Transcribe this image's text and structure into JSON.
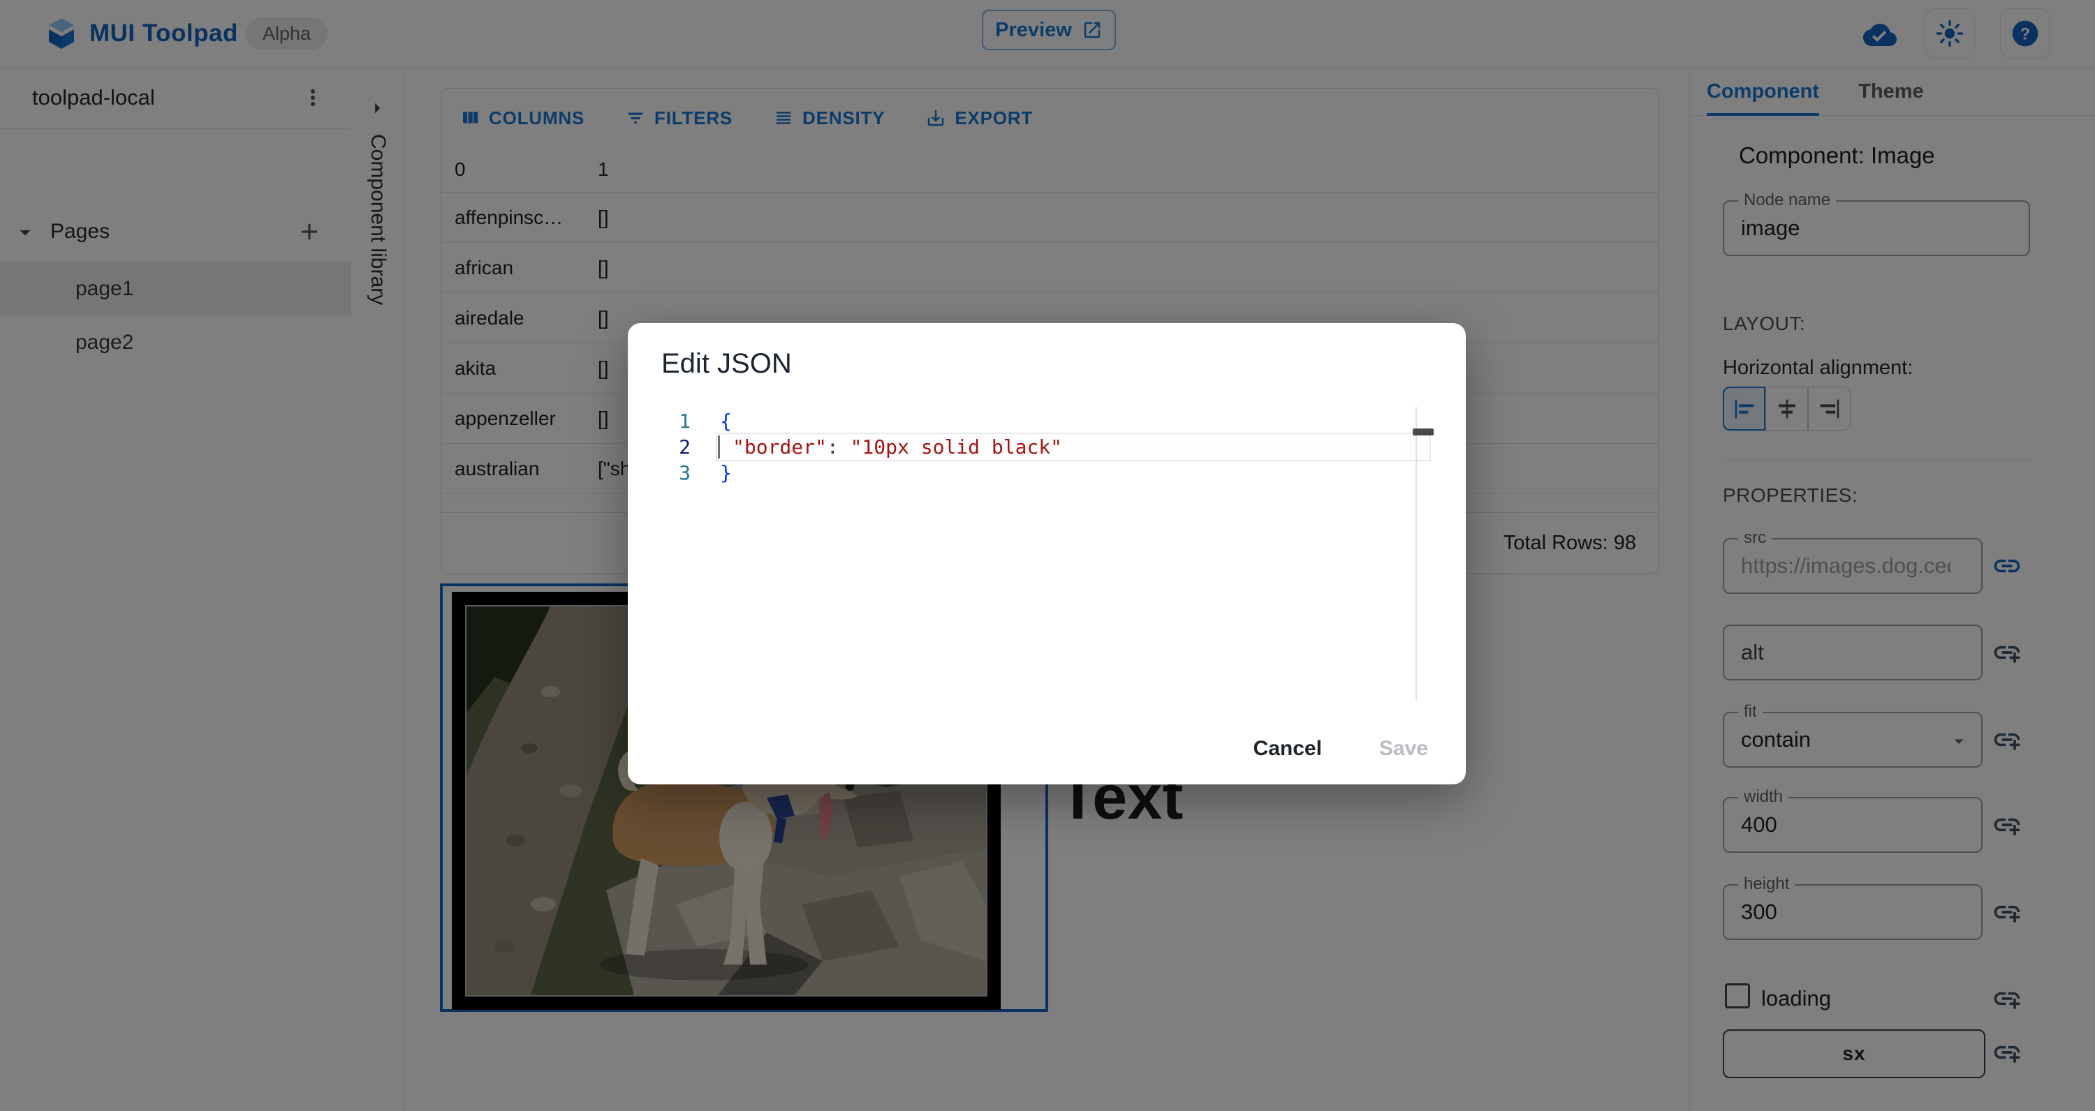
{
  "header": {
    "brand": "MUI Toolpad",
    "badge": "Alpha",
    "preview_label": "Preview"
  },
  "sidebar": {
    "project_name": "toolpad-local",
    "pages_label": "Pages",
    "pages": [
      {
        "label": "page1",
        "selected": true
      },
      {
        "label": "page2",
        "selected": false
      }
    ]
  },
  "library": {
    "label": "Component library"
  },
  "grid": {
    "toolbar": [
      {
        "label": "COLUMNS"
      },
      {
        "label": "FILTERS"
      },
      {
        "label": "DENSITY"
      },
      {
        "label": "EXPORT"
      }
    ],
    "columns": [
      "0",
      "1"
    ],
    "rows": [
      {
        "breed": "affenpinsc…",
        "value": "[]"
      },
      {
        "breed": "african",
        "value": "[]"
      },
      {
        "breed": "airedale",
        "value": "[]"
      },
      {
        "breed": "akita",
        "value": "[]"
      },
      {
        "breed": "appenzeller",
        "value": "[]"
      },
      {
        "breed": "australian",
        "value": "[\"sh"
      }
    ],
    "footer": "Total Rows: 98"
  },
  "canvas": {
    "text_component": "Text"
  },
  "modal": {
    "title": "Edit JSON",
    "lines": [
      {
        "num": "1",
        "code": "{"
      },
      {
        "num": "2",
        "key": "\"border\"",
        "sep": ": ",
        "value": "\"10px solid black\""
      },
      {
        "num": "3",
        "code": "}"
      }
    ],
    "cancel_label": "Cancel",
    "save_label": "Save"
  },
  "inspector": {
    "tabs": [
      {
        "label": "Component",
        "active": true
      },
      {
        "label": "Theme",
        "active": false
      }
    ],
    "heading": "Component: Image",
    "node_name": {
      "label": "Node name",
      "value": "image"
    },
    "layout_label": "LAYOUT:",
    "halign_label": "Horizontal alignment:",
    "properties_label": "PROPERTIES:",
    "src": {
      "label": "src",
      "value": "https://images.dog.ceo/b"
    },
    "alt": {
      "text": "alt"
    },
    "fit": {
      "label": "fit",
      "value": "contain"
    },
    "width": {
      "label": "width",
      "value": "400"
    },
    "height": {
      "label": "height",
      "value": "300"
    },
    "loading_label": "loading",
    "sx_label": "sx"
  },
  "colors": {
    "accent": "#1976d2",
    "brand_blue": "#1565c0",
    "selection_outline": "#1565c0",
    "backdrop": "rgba(0,0,0,0.5)",
    "code_string": "#a31515",
    "code_brace": "#0431fa",
    "line_number": "#237893",
    "line_number_active": "#0b216f",
    "save_disabled": "#b9bdc1"
  }
}
